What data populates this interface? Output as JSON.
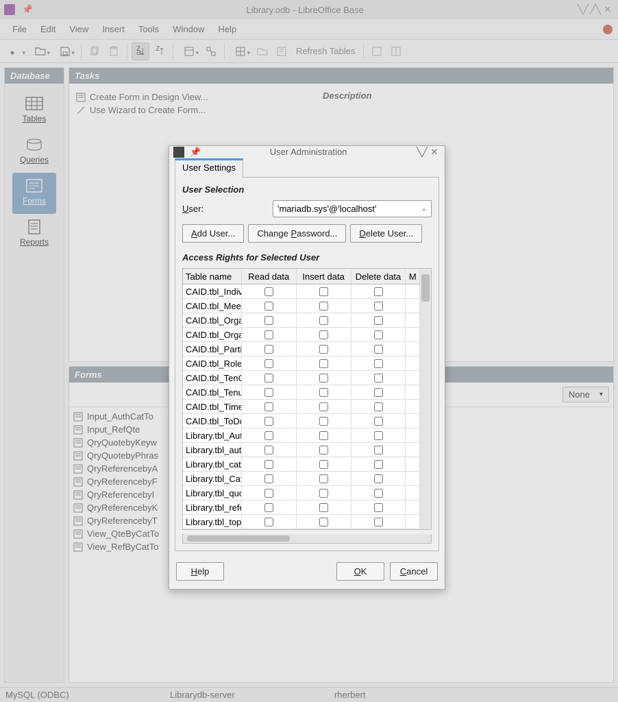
{
  "window": {
    "title": "Library.odb - LibreOffice Base"
  },
  "menu": {
    "file": "File",
    "edit": "Edit",
    "view": "View",
    "insert": "Insert",
    "tools": "Tools",
    "window": "Window",
    "help": "Help"
  },
  "toolbar": {
    "refresh": "Refresh Tables"
  },
  "sidebar": {
    "header": "Database",
    "items": [
      {
        "label": "Tables"
      },
      {
        "label": "Queries"
      },
      {
        "label": "Forms"
      },
      {
        "label": "Reports"
      }
    ]
  },
  "tasks": {
    "header": "Tasks",
    "items": [
      "Create Form in Design View...",
      "Use Wizard to Create Form..."
    ],
    "description_label": "Description"
  },
  "forms_panel": {
    "header": "Forms",
    "view_mode": "None",
    "items": [
      "Input_AuthCatTo",
      "Input_RefQte",
      "QryQuotebyKeyw",
      "QryQuotebyPhras",
      "QryReferencebyA",
      "QryReferencebyF",
      "QryReferencebyI",
      "QryReferencebyK",
      "QryReferencebyT",
      "View_QteByCatTo",
      "View_RefByCatTo"
    ]
  },
  "statusbar": {
    "driver": "MySQL (ODBC)",
    "server": "Librarydb-server",
    "user": "rherbert"
  },
  "dialog": {
    "title": "User Administration",
    "tab": "User Settings",
    "section1": "User Selection",
    "user_label": "User:",
    "user_value": "'mariadb.sys'@'localhost'",
    "add": "Add User...",
    "change": "Change Password...",
    "delete": "Delete User...",
    "section2": "Access Rights for Selected User",
    "columns": [
      "Table name",
      "Read data",
      "Insert data",
      "Delete data",
      "M"
    ],
    "rows": [
      "CAID.tbl_Individ",
      "CAID.tbl_Meetin",
      "CAID.tbl_Organi",
      "CAID.tbl_Organi",
      "CAID.tbl_Particip",
      "CAID.tbl_Role",
      "CAID.tbl_TenClm",
      "CAID.tbl_Tenure",
      "CAID.tbl_Time",
      "CAID.tbl_ToDo",
      "Library.tbl_Auth",
      "Library.tbl_auth",
      "Library.tbl_categ",
      "Library.tbl_Cate",
      "Library.tbl_quot",
      "Library.tbl_refer",
      "Library.tbl_topic"
    ],
    "help": "Help",
    "ok": "OK",
    "cancel": "Cancel"
  }
}
